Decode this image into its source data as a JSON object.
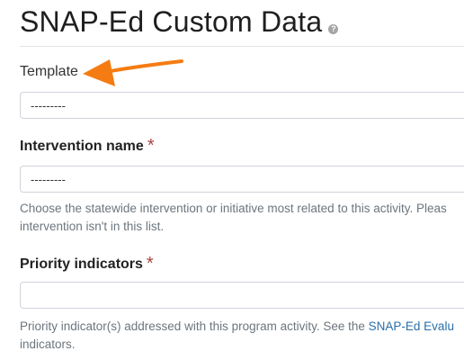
{
  "header": {
    "title": "SNAP-Ed Custom Data",
    "help_icon_glyph": "?"
  },
  "form": {
    "template": {
      "label": "Template",
      "value": "---------"
    },
    "intervention": {
      "label": "Intervention name",
      "required_mark": "*",
      "value": "---------",
      "help_line1": "Choose the statewide intervention or initiative most related to this activity. Pleas",
      "help_line2": "intervention isn't in this list."
    },
    "priority": {
      "label": "Priority indicators",
      "required_mark": "*",
      "value": "",
      "help_line1_text": "Priority indicator(s) addressed with this program activity. See the ",
      "help_line1_link": "SNAP-Ed Evalu",
      "help_line2": "indicators."
    }
  },
  "annotation": {
    "arrow_color": "#f57c12",
    "icon": "arrow-pointer-icon"
  },
  "colors": {
    "required": "#a94442",
    "link": "#2a6fa8",
    "help_text": "#6c757d"
  }
}
